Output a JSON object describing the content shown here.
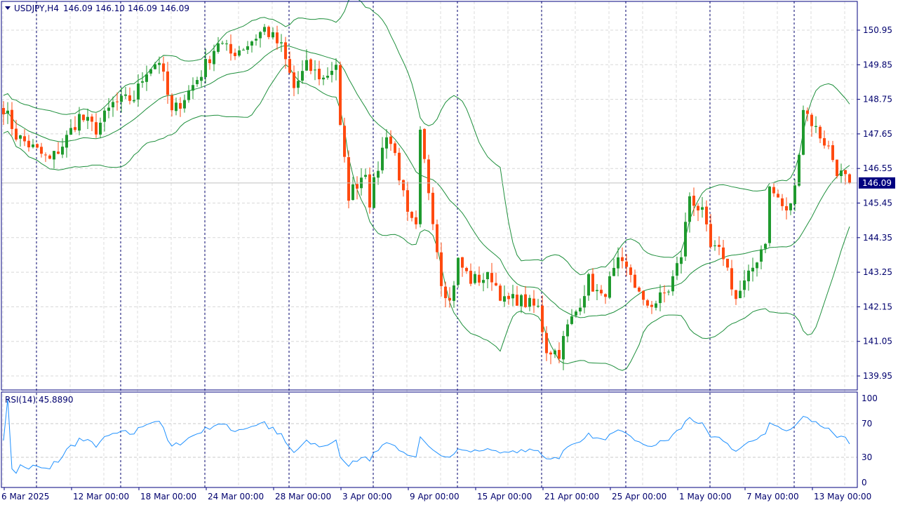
{
  "header": {
    "symbol": "USDJPY,H4",
    "open": "146.09",
    "high": "146.10",
    "low": "146.09",
    "close": "146.09"
  },
  "current_price": "146.09",
  "price_axis": [
    "150.95",
    "149.85",
    "148.75",
    "147.65",
    "146.55",
    "145.45",
    "144.35",
    "143.25",
    "142.15",
    "141.05",
    "139.95"
  ],
  "rsi": {
    "label": "RSI(14) 45.8890",
    "levels": [
      "100",
      "70",
      "30",
      "0"
    ]
  },
  "time_axis": [
    "6 Mar 2025",
    "12 Mar 00:00",
    "18 Mar 00:00",
    "24 Mar 00:00",
    "28 Mar 00:00",
    "3 Apr 00:00",
    "9 Apr 00:00",
    "15 Apr 00:00",
    "21 Apr 00:00",
    "25 Apr 00:00",
    "1 May 00:00",
    "7 May 00:00",
    "13 May 00:00"
  ],
  "colors": {
    "bull": "#1f9a2e",
    "bear": "#ff4a10",
    "bands": "#1e8f3c",
    "rsi": "#1e90ff",
    "frame": "#00007f"
  },
  "chart_data": {
    "type": "candlestick",
    "title": "USDJPY,H4",
    "ylim": [
      139.7,
      151.5
    ],
    "indicators": [
      "Bollinger Bands(20,2)",
      "RSI(14)"
    ],
    "close_anchors": [
      [
        0,
        148.5
      ],
      [
        3,
        147.6
      ],
      [
        6,
        147.3
      ],
      [
        11,
        146.8
      ],
      [
        14,
        147.3
      ],
      [
        18,
        148.2
      ],
      [
        22,
        147.8
      ],
      [
        26,
        148.6
      ],
      [
        31,
        148.8
      ],
      [
        34,
        149.7
      ],
      [
        37,
        150.0
      ],
      [
        40,
        148.3
      ],
      [
        44,
        149.0
      ],
      [
        47,
        149.6
      ],
      [
        51,
        150.6
      ],
      [
        54,
        150.2
      ],
      [
        58,
        150.5
      ],
      [
        62,
        151.0
      ],
      [
        66,
        150.4
      ],
      [
        69,
        149.1
      ],
      [
        72,
        149.8
      ],
      [
        76,
        149.4
      ],
      [
        79,
        149.9
      ],
      [
        80,
        147.8
      ],
      [
        82,
        145.7
      ],
      [
        86,
        146.5
      ],
      [
        87,
        145.5
      ],
      [
        91,
        147.7
      ],
      [
        93,
        147.0
      ],
      [
        96,
        145.0
      ],
      [
        98,
        144.6
      ],
      [
        99,
        147.6
      ],
      [
        102,
        145.0
      ],
      [
        104,
        143.0
      ],
      [
        106,
        142.3
      ],
      [
        108,
        143.6
      ],
      [
        111,
        143.0
      ],
      [
        116,
        143.1
      ],
      [
        119,
        142.3
      ],
      [
        122,
        142.4
      ],
      [
        127,
        142.1
      ],
      [
        129,
        140.8
      ],
      [
        132,
        140.7
      ],
      [
        134,
        141.5
      ],
      [
        136,
        142.0
      ],
      [
        139,
        143.0
      ],
      [
        142,
        142.4
      ],
      [
        146,
        143.5
      ],
      [
        149,
        143.2
      ],
      [
        152,
        142.2
      ],
      [
        155,
        142.3
      ],
      [
        158,
        142.7
      ],
      [
        161,
        143.8
      ],
      [
        163,
        145.7
      ],
      [
        166,
        145.1
      ],
      [
        168,
        144.0
      ],
      [
        171,
        143.8
      ],
      [
        174,
        142.4
      ],
      [
        177,
        143.1
      ],
      [
        181,
        144.3
      ],
      [
        182,
        145.9
      ],
      [
        184,
        145.6
      ],
      [
        186,
        145.1
      ],
      [
        188,
        145.9
      ],
      [
        190,
        148.5
      ],
      [
        193,
        147.8
      ],
      [
        196,
        147.2
      ],
      [
        198,
        146.5
      ],
      [
        201,
        146.09
      ]
    ]
  }
}
